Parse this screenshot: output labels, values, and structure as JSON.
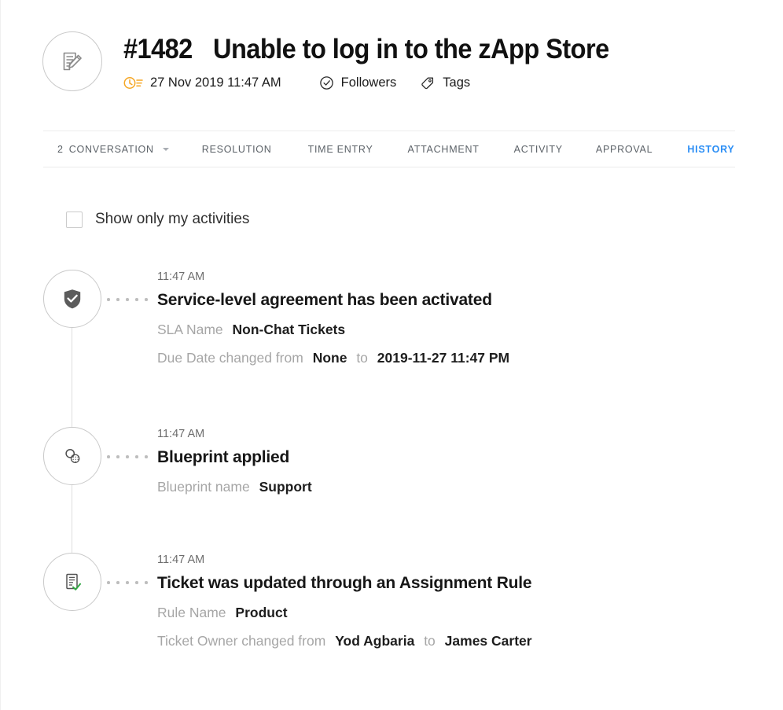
{
  "header": {
    "avatar_icon": "document-pencil-icon",
    "ticket_number": "#1482",
    "title": "Unable to log in to the zApp Store",
    "timestamp": "27 Nov 2019 11:47 AM",
    "timestamp_icon": "clock-list-icon",
    "followers_icon": "check-circle-icon",
    "followers_label": "Followers",
    "tags_icon": "tag-icon",
    "tags_label": "Tags",
    "accent_orange": "#F5A623"
  },
  "tabs": {
    "active_color": "#2B8EF5",
    "items": [
      {
        "count": "2",
        "label": "CONVERSATION",
        "has_caret": true,
        "active": false
      },
      {
        "count": "",
        "label": "RESOLUTION",
        "has_caret": false,
        "active": false
      },
      {
        "count": "",
        "label": "TIME ENTRY",
        "has_caret": false,
        "active": false
      },
      {
        "count": "",
        "label": "ATTACHMENT",
        "has_caret": false,
        "active": false
      },
      {
        "count": "",
        "label": "ACTIVITY",
        "has_caret": false,
        "active": false
      },
      {
        "count": "",
        "label": "APPROVAL",
        "has_caret": false,
        "active": false
      },
      {
        "count": "",
        "label": "HISTORY",
        "has_caret": false,
        "active": true
      }
    ]
  },
  "filter": {
    "checked": false,
    "label": "Show only my activities"
  },
  "timeline": {
    "entries": [
      {
        "icon": "shield-check-icon",
        "time": "11:47 AM",
        "title": "Service-level agreement has been activated",
        "details": [
          {
            "parts": [
              {
                "text": "SLA Name",
                "strong": false
              },
              {
                "text": "Non-Chat Tickets",
                "strong": true
              }
            ]
          },
          {
            "parts": [
              {
                "text": "Due Date changed from",
                "strong": false
              },
              {
                "text": "None",
                "strong": true
              },
              {
                "text": "to",
                "strong": false
              },
              {
                "text": "2019-11-27 11:47 PM",
                "strong": true
              }
            ]
          }
        ]
      },
      {
        "icon": "blueprint-circles-icon",
        "time": "11:47 AM",
        "title": "Blueprint applied",
        "details": [
          {
            "parts": [
              {
                "text": "Blueprint name",
                "strong": false
              },
              {
                "text": "Support",
                "strong": true
              }
            ]
          }
        ]
      },
      {
        "icon": "document-check-icon",
        "time": "11:47 AM",
        "title": "Ticket was updated through an Assignment Rule",
        "details": [
          {
            "parts": [
              {
                "text": "Rule Name",
                "strong": false
              },
              {
                "text": "Product",
                "strong": true
              }
            ]
          },
          {
            "parts": [
              {
                "text": "Ticket Owner changed from",
                "strong": false
              },
              {
                "text": "Yod Agbaria",
                "strong": true
              },
              {
                "text": "to",
                "strong": false
              },
              {
                "text": "James Carter",
                "strong": true
              }
            ]
          }
        ]
      }
    ]
  }
}
